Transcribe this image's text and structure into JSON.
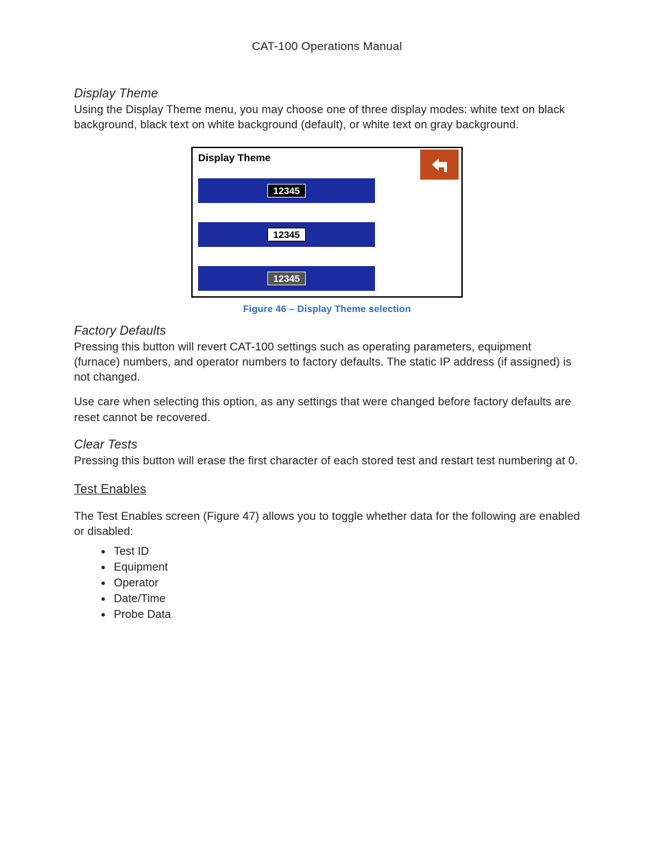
{
  "header": {
    "title": "CAT-100 Operations Manual"
  },
  "sections": {
    "display_theme": {
      "heading": "Display Theme",
      "body": "Using the Display Theme menu, you may choose one of three display modes: white text on black background, black text on white background (default), or white text on gray background."
    },
    "factory_defaults": {
      "heading": "Factory Defaults",
      "body1": "Pressing this button will revert CAT-100 settings such as operating parameters, equipment (furnace) numbers, and operator numbers to factory defaults. The static IP address (if assigned) is not changed.",
      "body2": "Use care when selecting this option, as any settings that were changed before factory defaults are reset cannot be recovered."
    },
    "clear_tests": {
      "heading": "Clear Tests",
      "body": "Pressing this button will erase the first character of each stored test and restart test numbering at 0."
    },
    "test_enables": {
      "heading": "Test Enables",
      "intro": "The Test Enables screen (Figure 47) allows you to toggle whether data for the following are enabled or disabled:",
      "items": [
        "Test ID",
        "Equipment",
        "Operator",
        "Date/Time",
        "Probe Data"
      ]
    }
  },
  "figure": {
    "title": "Display Theme",
    "caption": "Figure 46 – Display Theme selection",
    "back_icon": "back-arrow-icon",
    "options": [
      {
        "sample": "12345",
        "style": "dark"
      },
      {
        "sample": "12345",
        "style": "light"
      },
      {
        "sample": "12345",
        "style": "gray"
      }
    ],
    "colors": {
      "bar": "#1a2ca0",
      "back_button": "#c04a1c",
      "caption": "#2a6fb4"
    }
  }
}
